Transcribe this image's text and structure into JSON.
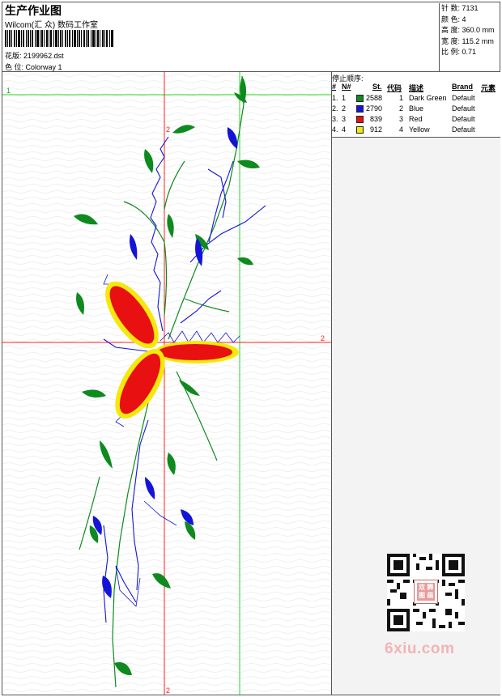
{
  "header": {
    "title": "生产作业图",
    "company": "Wilcom(汇 众) 数码工作室",
    "pattern_label": "花版:",
    "pattern_value": "2199962.dst",
    "colorway_label": "色 位:",
    "colorway_value": "Colorway 1"
  },
  "stats": {
    "stitches_label": "针 数:",
    "stitches_value": "7131",
    "colors_label": "颜 色:",
    "colors_value": "4",
    "height_label": "高 度:",
    "height_value": "360.0 mm",
    "width_label": "宽 度:",
    "width_value": "115.2 mm",
    "scale_label": "比 例:",
    "scale_value": "0.71"
  },
  "stop_sequence": {
    "title": "停止顺序:",
    "columns": [
      "#",
      "N#",
      "St.",
      "代码",
      "描述",
      "Brand",
      "元素"
    ],
    "rows": [
      {
        "num": "1.",
        "n": "1",
        "color": "#0e8a1e",
        "stitches": "2588",
        "code": "1",
        "desc": "Dark Green",
        "brand": "Default"
      },
      {
        "num": "2.",
        "n": "2",
        "color": "#1414d8",
        "stitches": "2790",
        "code": "2",
        "desc": "Blue",
        "brand": "Default"
      },
      {
        "num": "3.",
        "n": "3",
        "color": "#e81010",
        "stitches": "839",
        "code": "3",
        "desc": "Red",
        "brand": "Default"
      },
      {
        "num": "4.",
        "n": "4",
        "color": "#f4e80c",
        "stitches": "912",
        "code": "4",
        "desc": "Yellow",
        "brand": "Default"
      }
    ]
  },
  "axes": {
    "green_h_label": "1",
    "red_h_label": "2",
    "red_v_label": "2"
  },
  "watermark": {
    "site": "6xiu.com",
    "qr_logo_text": "双 狮 图 画"
  },
  "colors": {
    "green": "#0e8a1e",
    "blue": "#1414d8",
    "red": "#e81010",
    "yellow": "#f4e80c",
    "guide_red": "#ff2020",
    "guide_green": "#22dd22"
  }
}
